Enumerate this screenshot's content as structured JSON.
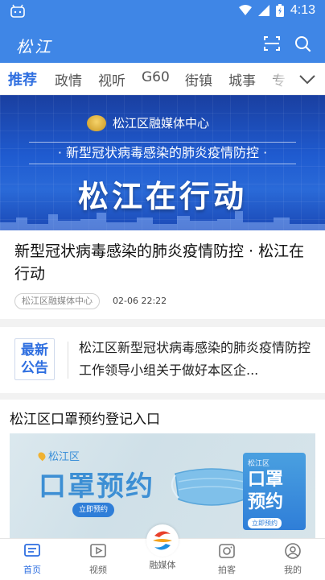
{
  "status": {
    "time": "4:13"
  },
  "header": {
    "logo": "松江"
  },
  "tabs": [
    {
      "label": "推荐",
      "active": true
    },
    {
      "label": "政情"
    },
    {
      "label": "视听"
    },
    {
      "label": "G60"
    },
    {
      "label": "街镇"
    },
    {
      "label": "城事"
    },
    {
      "label": "专"
    }
  ],
  "hero": {
    "org": "松江区融媒体中心",
    "subline": "· 新型冠状病毒感染的肺炎疫情防控 ·",
    "headline": "松江在行动"
  },
  "article": {
    "title": "新型冠状病毒感染的肺炎疫情防控 · 松江在行动",
    "source": "松江区融媒体中心",
    "date": "02-06 22:22"
  },
  "notice": {
    "badge_line1": "最新",
    "badge_line2": "公告",
    "text": "松江区新型冠状病毒感染的肺炎疫情防控工作领导小组关于做好本区企..."
  },
  "mask_section": {
    "label": "松江区口罩预约登记入口",
    "location": "松江区",
    "headline": "口罩预约",
    "button": "立即预约",
    "side_location": "松江区",
    "side_headline_1": "口罩",
    "side_headline_2": "预约",
    "side_button": "立即预约"
  },
  "bottom_nav": [
    {
      "label": "首页",
      "icon": "home-icon",
      "active": true
    },
    {
      "label": "视频",
      "icon": "video-icon"
    },
    {
      "label": "融媒体",
      "icon": "media-logo-icon"
    },
    {
      "label": "拍客",
      "icon": "camera-icon"
    },
    {
      "label": "我的",
      "icon": "profile-icon"
    }
  ],
  "colors": {
    "brand": "#3f86e6",
    "accent": "#2f6fe0"
  }
}
